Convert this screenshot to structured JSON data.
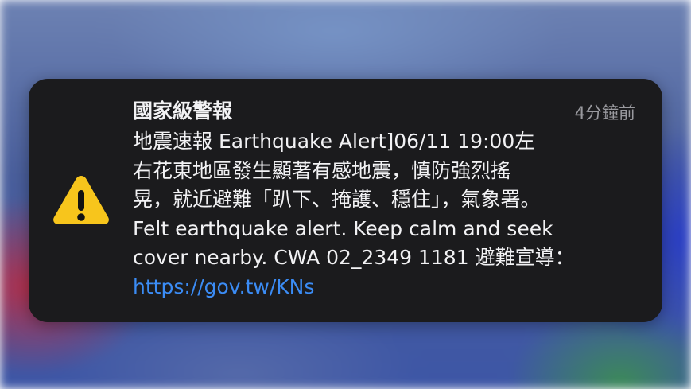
{
  "notification": {
    "app_title": "國家級警報",
    "timestamp": "4分鐘前",
    "icon": "warning-triangle-icon",
    "icon_color": "#f7c51c",
    "body_lines": [
      "地震速報 Earthquake Alert]06/11 19:00左",
      "右花東地區發生顯著有感地震，慎防強烈搖",
      "晃，就近避難「趴下、掩護、穩住」，氣象署。",
      "Felt earthquake alert. Keep calm and seek",
      "cover nearby. CWA 02_2349 1181 避難宣導："
    ],
    "link_text": "https://gov.tw/KNs",
    "link_color": "#3b8cf5"
  }
}
